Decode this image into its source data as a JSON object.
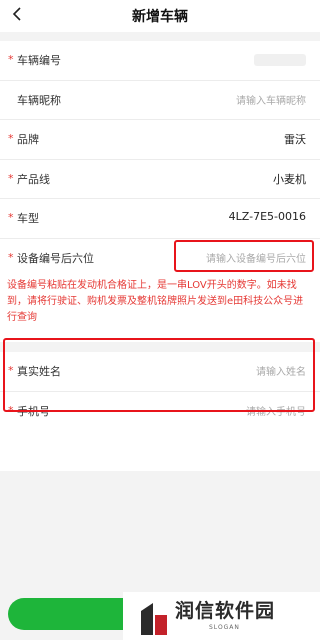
{
  "header": {
    "title": "新增车辆",
    "back_icon": "chevron-left-icon"
  },
  "fields": {
    "vehicle_no": {
      "required": "*",
      "label": "车辆编号",
      "value": ""
    },
    "nickname": {
      "label": "车辆昵称",
      "placeholder": "请输入车辆昵称"
    },
    "brand": {
      "required": "*",
      "label": "品牌",
      "value": "雷沃"
    },
    "product_line": {
      "required": "*",
      "label": "产品线",
      "value": "小麦机"
    },
    "model": {
      "required": "*",
      "label": "车型",
      "value": "4LZ-7E5-0016"
    },
    "device_last6": {
      "required": "*",
      "label": "设备编号后六位",
      "placeholder": "请输入设备编号后六位"
    }
  },
  "device_note": "设备编号粘贴在发动机合格证上，是一串LOV开头的数字。如未找到，请将行驶证、购机发票及整机铭牌照片发送到e田科技公众号进行查询",
  "owner": {
    "real_name": {
      "required": "*",
      "label": "真实姓名",
      "placeholder": "请输入姓名"
    },
    "phone": {
      "required": "*",
      "label": "手机号",
      "placeholder": "请输入手机号"
    }
  },
  "watermark": {
    "brand": "润信软件园",
    "slogan": "SLOGAN"
  },
  "colors": {
    "required": "#e53935",
    "highlight": "#e8141b",
    "primary": "#1eb53a",
    "background": "#f3f3f3"
  }
}
